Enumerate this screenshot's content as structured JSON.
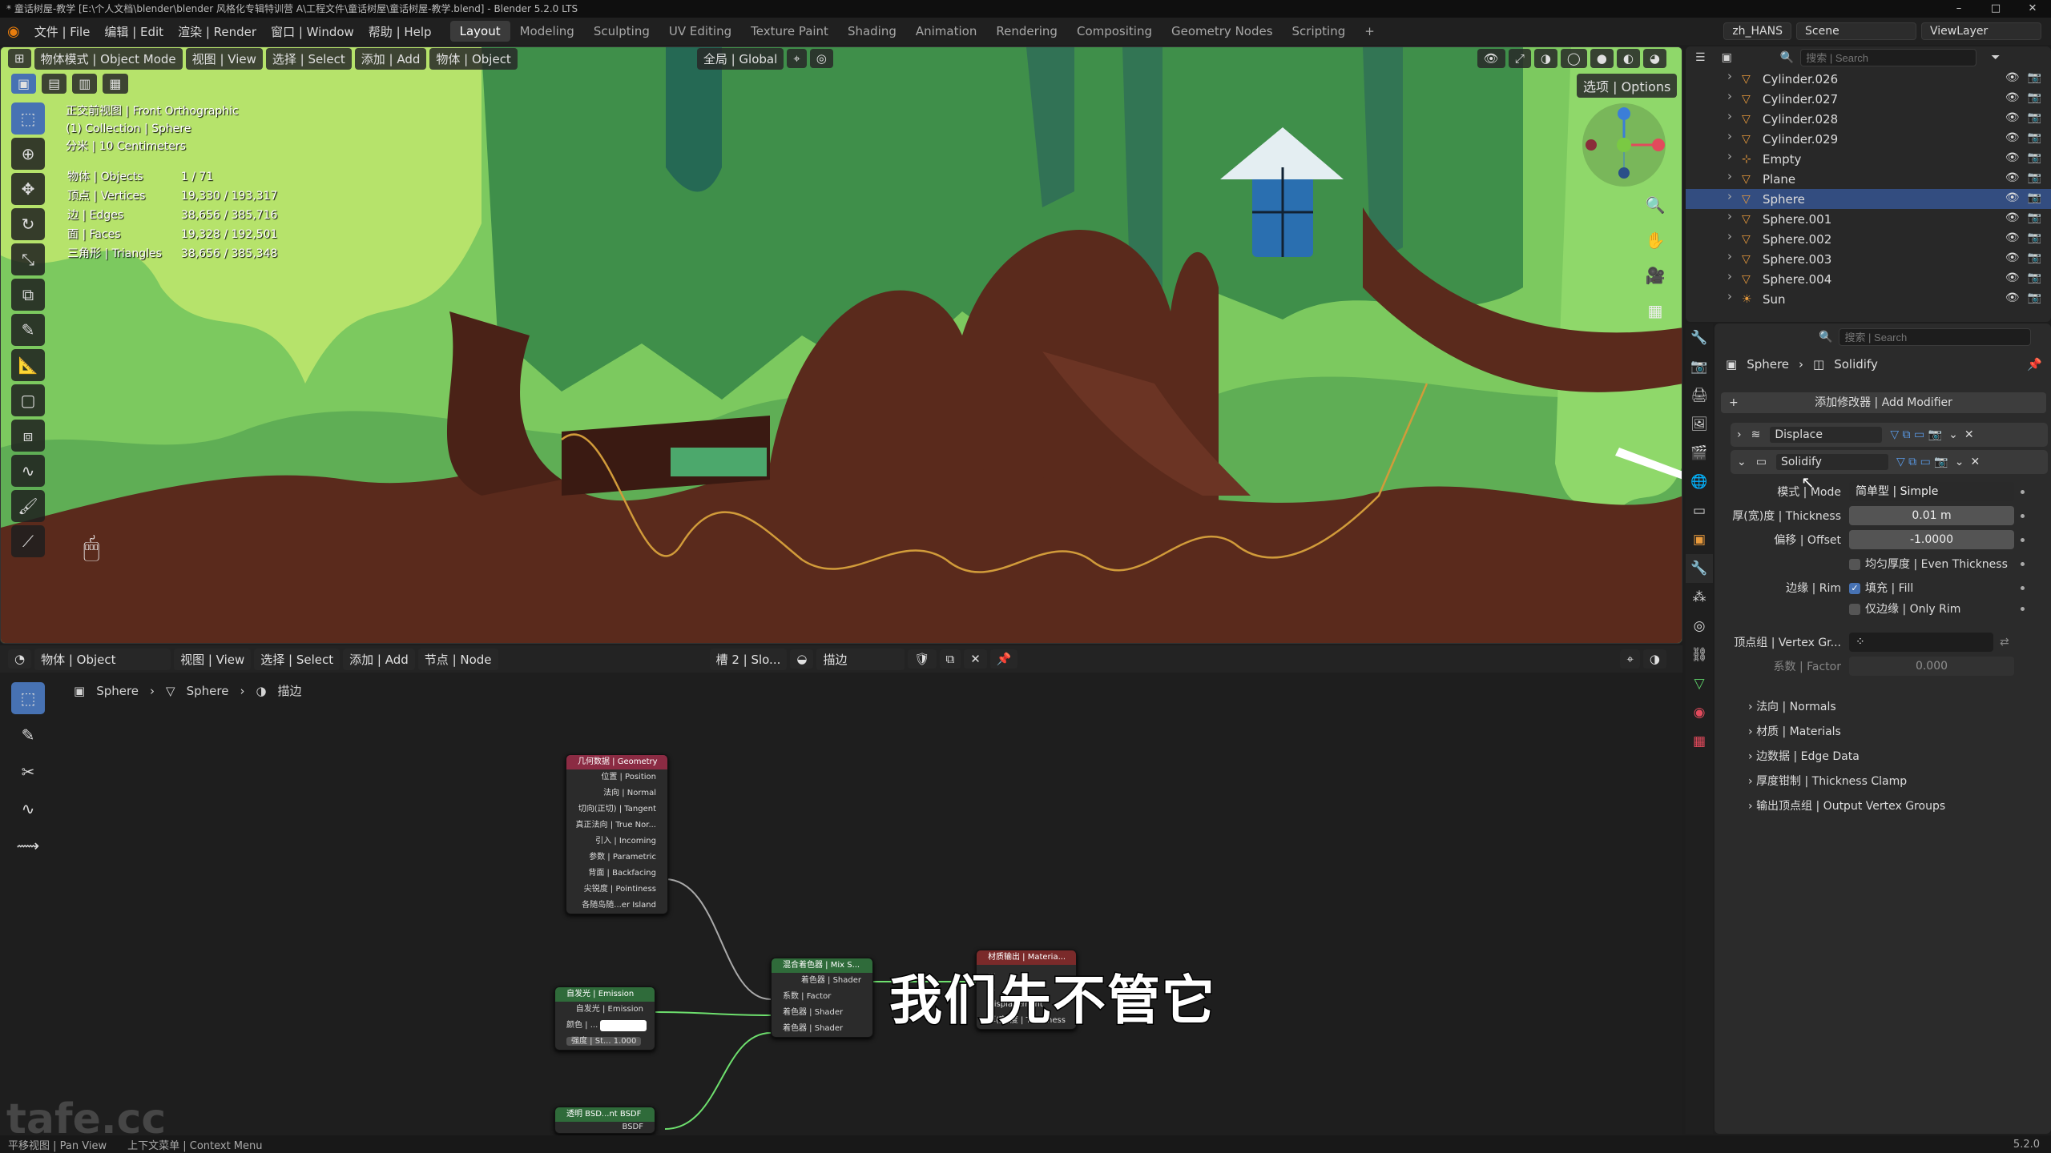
{
  "title_bar": {
    "text": "* 童话树屋-教学 [E:\\个人文档\\blender\\blender 风格化专辑特训营 A\\工程文件\\童话树屋\\童话树屋-教学.blend] - Blender 5.2.0 LTS",
    "minimize": "–",
    "maximize": "□",
    "close": "✕"
  },
  "menu": {
    "items": [
      "文件 | File",
      "编辑 | Edit",
      "渲染 | Render",
      "窗口 | Window",
      "帮助 | Help"
    ]
  },
  "workspaces": [
    "Layout",
    "Modeling",
    "Sculpting",
    "UV Editing",
    "Texture Paint",
    "Shading",
    "Animation",
    "Rendering",
    "Compositing",
    "Geometry Nodes",
    "Scripting",
    "+"
  ],
  "top_right": {
    "language": "zh_HANS",
    "scene": "Scene",
    "view_layer": "ViewLayer"
  },
  "viewport": {
    "mode": "物体模式 | Object Mode",
    "menus": [
      "视图 | View",
      "选择 | Select",
      "添加 | Add",
      "物体 | Object"
    ],
    "transform": "全局 | Global",
    "options": "选项 | Options",
    "overlay": {
      "view": "正交前视图 | Front Orthographic",
      "collection": "(1) Collection | Sphere",
      "scale": "分米 | 10 Centimeters"
    },
    "stats": [
      {
        "label": "物体 | Objects",
        "value": "1 / 71"
      },
      {
        "label": "顶点 | Vertices",
        "value": "19,330 / 193,317"
      },
      {
        "label": "边 | Edges",
        "value": "38,656 / 385,716"
      },
      {
        "label": "面 | Faces",
        "value": "19,328 / 192,501"
      },
      {
        "label": "三角形 | Triangles",
        "value": "38,656 / 385,348"
      }
    ]
  },
  "node_editor": {
    "mode": "物体 | Object",
    "menus": [
      "视图 | View",
      "选择 | Select",
      "添加 | Add",
      "节点 | Node"
    ],
    "slot": "槽 2 | Slo...",
    "material": "描边",
    "breadcrumb": [
      "Sphere",
      "Sphere",
      "描边"
    ],
    "nodes": {
      "geometry": {
        "title": "几何数据 | Geometry",
        "outputs": [
          "位置 | Position",
          "法向 | Normal",
          "切向(正切) | Tangent",
          "真正法向 | True Nor...",
          "引入 | Incoming",
          "参数 | Parametric",
          "背面 | Backfacing",
          "尖锐度 | Pointiness",
          "各随岛随...er Island"
        ]
      },
      "emission": {
        "title": "自发光 | Emission",
        "outputs": [
          "自发光 | Emission"
        ],
        "inputs": [
          "颜色 | ...",
          "强度 | St...  1.000"
        ]
      },
      "mix": {
        "title": "混合着色器 | Mix S...",
        "outputs": [
          "着色器 | Shader"
        ],
        "inputs": [
          "系数 | Factor",
          "着色器 | Shader",
          "着色器 | Shader"
        ]
      },
      "output": {
        "title": "材质输出 | Materia...",
        "inputs": [
          "Displacement",
          "厚(宽)度 | Thickness"
        ]
      },
      "transparent": {
        "title": "透明 BSD...nt BSDF",
        "outputs": [
          "BSDF"
        ]
      }
    }
  },
  "subtitle": "我们先不管它",
  "watermark": "tafe.cc",
  "status_bar": [
    "平移视图 | Pan View",
    "上下文菜单 | Context Menu",
    "5.2.0"
  ],
  "outliner": {
    "search_placeholder": "搜索 | Search",
    "items": [
      {
        "name": "Cylinder.026",
        "selected": false
      },
      {
        "name": "Cylinder.027",
        "selected": false
      },
      {
        "name": "Cylinder.028",
        "selected": false
      },
      {
        "name": "Cylinder.029",
        "selected": false
      },
      {
        "name": "Empty",
        "selected": false
      },
      {
        "name": "Plane",
        "selected": false
      },
      {
        "name": "Sphere",
        "selected": true
      },
      {
        "name": "Sphere.001",
        "selected": false
      },
      {
        "name": "Sphere.002",
        "selected": false
      },
      {
        "name": "Sphere.003",
        "selected": false
      },
      {
        "name": "Sphere.004",
        "selected": false
      },
      {
        "name": "Sun",
        "selected": false
      }
    ]
  },
  "properties": {
    "search_placeholder": "搜索 | Search",
    "breadcrumb": [
      "Sphere",
      "Solidify"
    ],
    "add_modifier": "添加修改器 | Add Modifier",
    "modifiers": [
      "Displace",
      "Solidify"
    ],
    "solidify": {
      "mode_label": "模式 | Mode",
      "mode_value": "简单型 | Simple",
      "thickness_label": "厚(宽)度 | Thickness",
      "thickness_value": "0.01 m",
      "offset_label": "偏移 | Offset",
      "offset_value": "-1.0000",
      "even_thickness": "均匀厚度 | Even Thickness",
      "rim_label": "边缘 | Rim",
      "fill": "填充 | Fill",
      "only_rim": "仅边缘 | Only Rim",
      "vgroup_label": "顶点组 | Vertex Gr...",
      "factor_label": "系数 | Factor",
      "factor_value": "0.000",
      "subpanels": [
        "法向 | Normals",
        "材质 | Materials",
        "边数据 | Edge Data",
        "厚度钳制 | Thickness Clamp",
        "输出顶点组 | Output Vertex Groups"
      ]
    }
  },
  "colors": {
    "accent": "#4772b3",
    "selection": "#334d80",
    "tree_brown": "#5a2a1c",
    "foliage": "#6fc25e"
  }
}
